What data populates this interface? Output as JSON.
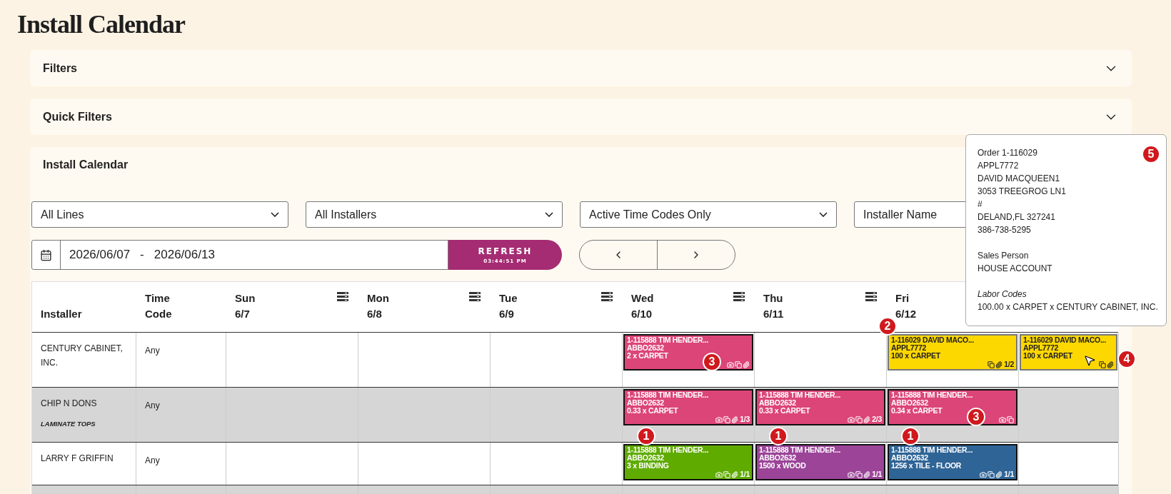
{
  "page_title": "Install Calendar",
  "sections": [
    {
      "title": "Filters",
      "expanded": false
    },
    {
      "title": "Quick Filters",
      "expanded": false
    }
  ],
  "calendar": {
    "title": "Install Calendar",
    "selects": [
      {
        "value": "All Lines"
      },
      {
        "value": "All Installers"
      },
      {
        "value": "Active Time Codes Only"
      }
    ],
    "installer_field": {
      "placeholder": "Installer Name"
    },
    "date_range": {
      "start": "2026/06/07",
      "separator": "-",
      "end": "2026/06/13"
    },
    "refresh": {
      "label": "REFRESH",
      "time": "03:44:51 PM"
    },
    "fixed_columns": [
      "Installer",
      "Time Code"
    ],
    "days": [
      {
        "day": "Sun",
        "date": "6/7",
        "menu": true
      },
      {
        "day": "Mon",
        "date": "6/8",
        "menu": true
      },
      {
        "day": "Tue",
        "date": "6/9",
        "menu": true
      },
      {
        "day": "Wed",
        "date": "6/10",
        "menu": true
      },
      {
        "day": "Thu",
        "date": "6/11",
        "menu": true
      },
      {
        "day": "Fri",
        "date": "6/12",
        "menu": false
      }
    ],
    "rows": [
      {
        "installer": "CENTURY CABINET, INC.",
        "time_code": "Any",
        "shaded": false,
        "cells": [
          [],
          [],
          [],
          [
            {
              "title": "1-115888 TIM HENDER...",
              "code": "ABBO2632",
              "line": "2 x CARPET",
              "color": "#dc4577",
              "camera": true,
              "copy": true,
              "clip": true,
              "marker": {
                "label": "3",
                "kind": "bottom"
              }
            }
          ],
          [],
          [
            {
              "title": "1-116029 DAVID MACO...",
              "code": "APPL7772",
              "line": "100 x CARPET",
              "color": "#fdd700",
              "camera": false,
              "copy": true,
              "clip": true,
              "count": "1/2",
              "marker": {
                "label": "2",
                "kind": "corner"
              }
            }
          ],
          [
            {
              "title": "1-116029 DAVID MACO...",
              "code": "APPL7772",
              "line": "100 x CARPET",
              "color": "#fdd700",
              "camera": false,
              "copy": true,
              "clip": true,
              "hovered": true,
              "marker": {
                "label": "4",
                "kind": "side"
              }
            }
          ]
        ]
      },
      {
        "installer": "CHIP N DONS",
        "subtitle": "LAMINATE TOPS",
        "time_code": "Any",
        "shaded": true,
        "cells": [
          [],
          [],
          [],
          [
            {
              "title": "1-115888 TIM HENDER...",
              "code": "ABBO2632",
              "line": "0.33 x CARPET",
              "color": "#dc4577",
              "camera": true,
              "copy": true,
              "clip": true,
              "count": "1/3"
            }
          ],
          [
            {
              "title": "1-115888 TIM HENDER...",
              "code": "ABBO2632",
              "line": "0.33 x CARPET",
              "color": "#dc4577",
              "camera": true,
              "copy": true,
              "clip": true,
              "count": "2/3"
            }
          ],
          [
            {
              "title": "1-115888 TIM HENDER...",
              "code": "ABBO2632",
              "line": "0.34 x CARPET",
              "color": "#dc4577",
              "camera": true,
              "copy": true,
              "clip": false,
              "marker": {
                "label": "3",
                "kind": "bottom"
              }
            }
          ],
          []
        ]
      },
      {
        "installer": "LARRY F GRIFFIN",
        "time_code": "Any",
        "shaded": false,
        "cells": [
          [],
          [],
          [],
          [
            {
              "title": "1-115888 TIM HENDER...",
              "code": "ABBO2632",
              "line": "3 x BINDING",
              "color": "#5fab00",
              "camera": true,
              "copy": true,
              "clip": true,
              "count": "1/1",
              "marker": {
                "label": "1",
                "kind": "top"
              }
            }
          ],
          [
            {
              "title": "1-115888 TIM HENDER...",
              "code": "ABBO2632",
              "line": "1500 x WOOD",
              "color": "#9b4498",
              "camera": true,
              "copy": true,
              "clip": true,
              "count": "1/1",
              "marker": {
                "label": "1",
                "kind": "top"
              }
            }
          ],
          [
            {
              "title": "1-115888 TIM HENDER...",
              "code": "ABBO2632",
              "line": "1256 x TILE - FLOOR",
              "color": "#2f6496",
              "camera": true,
              "copy": true,
              "clip": true,
              "count": "1/1",
              "marker": {
                "label": "1",
                "kind": "top"
              }
            }
          ],
          []
        ]
      },
      {
        "shaded": true,
        "cells": [
          [],
          [],
          [],
          [],
          [],
          [],
          []
        ]
      }
    ]
  },
  "tooltip": {
    "marker": "5",
    "groups": [
      {
        "lines": [
          "Order 1-116029",
          "APPL7772",
          "DAVID MACQUEEN1",
          "3053 TREEGROG LN1",
          "#",
          "DELAND,FL 327241",
          "386-738-5295"
        ]
      },
      {
        "lines": [
          "Sales Person",
          "HOUSE ACCOUNT"
        ]
      },
      {
        "heading": "Labor Codes",
        "lines": [
          "100.00 x CARPET x CENTURY CABINET, INC."
        ]
      }
    ]
  }
}
